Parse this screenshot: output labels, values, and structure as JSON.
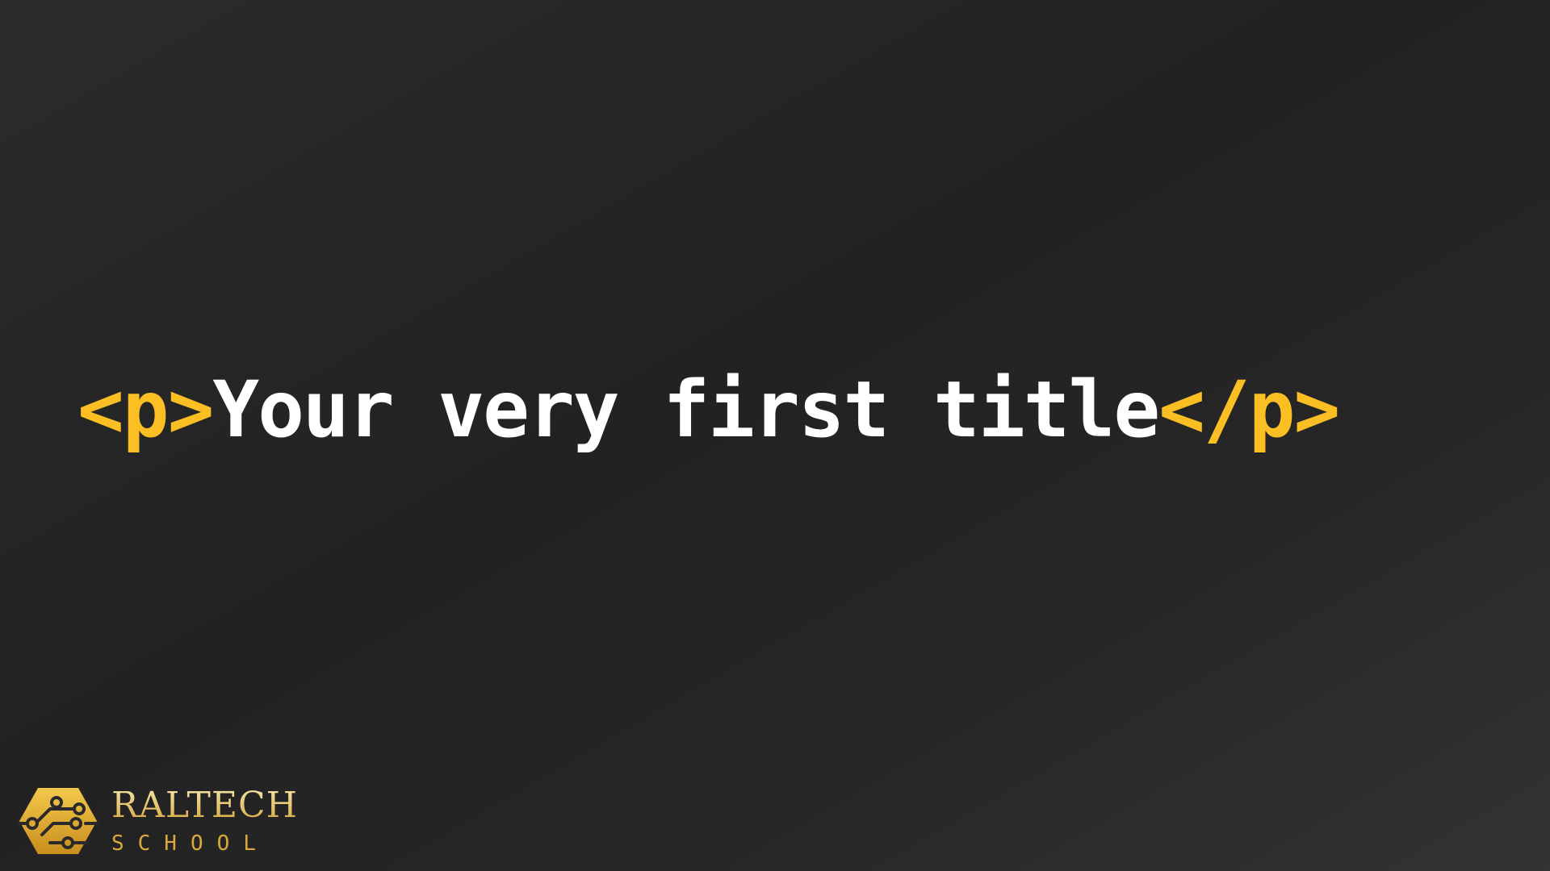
{
  "title": {
    "open_tag": "<p>",
    "text": "Your very first title",
    "close_tag": "</p>"
  },
  "logo": {
    "name": "RALTECH",
    "sub": "SCHOOL",
    "icon": "circuit-hexagon-icon"
  },
  "colors": {
    "tag": "#fbbf24",
    "text": "#ffffff",
    "logo_gold": "#d9a93d"
  }
}
